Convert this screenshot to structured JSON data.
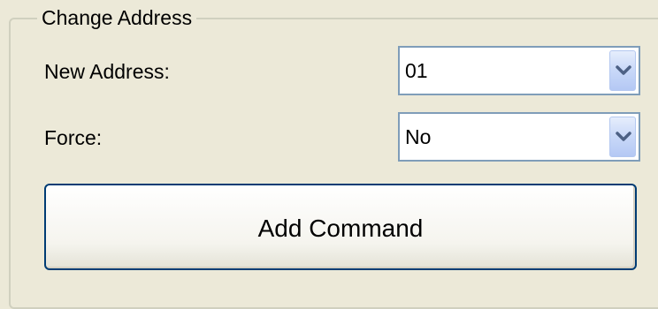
{
  "group": {
    "title": "Change Address"
  },
  "fields": {
    "new_address": {
      "label": "New Address:",
      "value": "01"
    },
    "force": {
      "label": "Force:",
      "value": "No"
    }
  },
  "actions": {
    "add_command_label": "Add Command"
  },
  "icons": {
    "dropdown": "chevron-down-icon"
  },
  "colors": {
    "background": "#ece9d8",
    "select_border": "#7f9db9",
    "button_border": "#003c74",
    "arrow": "#4d6185"
  }
}
